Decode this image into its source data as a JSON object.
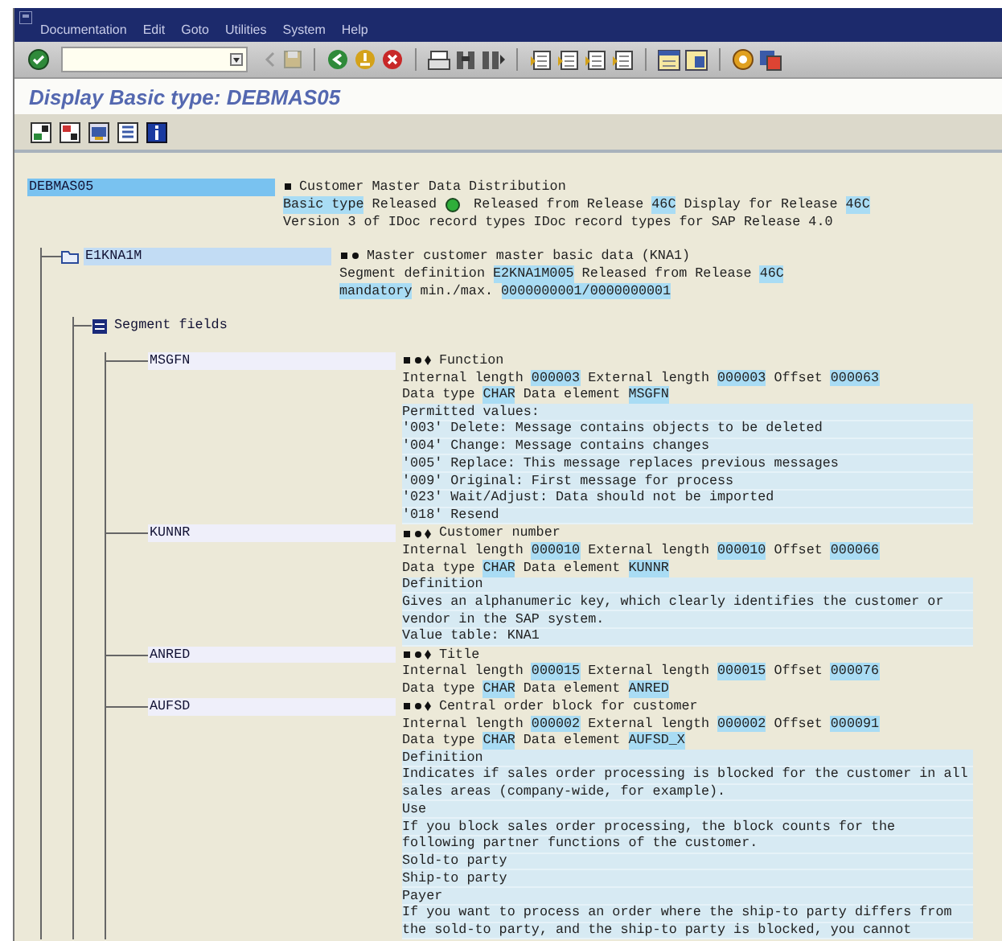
{
  "menu": [
    "Documentation",
    "Edit",
    "Goto",
    "Utilities",
    "System",
    "Help"
  ],
  "title": "Display Basic type: DEBMAS05",
  "tree": {
    "kind": "basic_type",
    "label": "DEBMAS05",
    "selected": true,
    "heading": "Customer Master Data Distribution",
    "lines": [
      {
        "shaded": false,
        "parts": [
          {
            "kind": "text",
            "text": "Basic type",
            "highlight": true
          },
          {
            "kind": "text",
            "text": " Released ",
            "highlight": false
          },
          {
            "kind": "light",
            "on": true
          },
          {
            "kind": "text",
            "text": " Released from Release ",
            "highlight": false
          },
          {
            "kind": "text",
            "text": "46C",
            "highlight": true
          },
          {
            "kind": "text",
            "text": " Display for Release ",
            "highlight": false
          },
          {
            "kind": "text",
            "text": "46C",
            "highlight": true
          }
        ]
      },
      {
        "shaded": false,
        "parts": [
          {
            "kind": "text",
            "text": "Version 3 of IDoc record types IDoc record types for SAP Release 4.0",
            "highlight": false
          }
        ]
      }
    ],
    "children": [
      {
        "kind": "segment",
        "label": "E1KNA1M",
        "selected": false,
        "heading": "Master customer master basic data (KNA1)",
        "lines": [
          {
            "shaded": false,
            "parts": [
              {
                "kind": "text",
                "text": "Segment definition ",
                "highlight": false
              },
              {
                "kind": "text",
                "text": "E2KNA1M005",
                "highlight": true
              },
              {
                "kind": "text",
                "text": " Released from Release ",
                "highlight": false
              },
              {
                "kind": "text",
                "text": "46C",
                "highlight": true
              }
            ]
          },
          {
            "shaded": false,
            "parts": [
              {
                "kind": "text",
                "text": "mandatory",
                "highlight": true
              },
              {
                "kind": "text",
                "text": " min./max. ",
                "highlight": false
              },
              {
                "kind": "text",
                "text": "0000000001/0000000001",
                "highlight": true
              }
            ]
          }
        ],
        "children": [
          {
            "kind": "group",
            "label": "Segment fields",
            "children": [
              {
                "kind": "field",
                "label": "MSGFN",
                "heading": "Function",
                "lines": [
                  {
                    "shaded": false,
                    "parts": [
                      {
                        "kind": "text",
                        "text": "Internal length ",
                        "highlight": false
                      },
                      {
                        "kind": "text",
                        "text": "000003",
                        "highlight": true
                      },
                      {
                        "kind": "text",
                        "text": " External length ",
                        "highlight": false
                      },
                      {
                        "kind": "text",
                        "text": "000003",
                        "highlight": true
                      },
                      {
                        "kind": "text",
                        "text": " Offset ",
                        "highlight": false
                      },
                      {
                        "kind": "text",
                        "text": "000063",
                        "highlight": true
                      }
                    ]
                  },
                  {
                    "shaded": false,
                    "parts": [
                      {
                        "kind": "text",
                        "text": "Data type ",
                        "highlight": false
                      },
                      {
                        "kind": "text",
                        "text": "CHAR",
                        "highlight": true
                      },
                      {
                        "kind": "text",
                        "text": " Data element ",
                        "highlight": false
                      },
                      {
                        "kind": "text",
                        "text": "MSGFN",
                        "highlight": true
                      }
                    ]
                  },
                  {
                    "shaded": true,
                    "parts": [
                      {
                        "kind": "text",
                        "text": "Permitted values:",
                        "highlight": false
                      }
                    ]
                  },
                  {
                    "shaded": true,
                    "parts": [
                      {
                        "kind": "text",
                        "text": "'003' Delete: Message contains objects to be deleted",
                        "highlight": false
                      }
                    ]
                  },
                  {
                    "shaded": true,
                    "parts": [
                      {
                        "kind": "text",
                        "text": "'004' Change: Message contains changes",
                        "highlight": false
                      }
                    ]
                  },
                  {
                    "shaded": true,
                    "parts": [
                      {
                        "kind": "text",
                        "text": "'005' Replace: This message replaces previous messages",
                        "highlight": false
                      }
                    ]
                  },
                  {
                    "shaded": true,
                    "parts": [
                      {
                        "kind": "text",
                        "text": "'009' Original: First message for process",
                        "highlight": false
                      }
                    ]
                  },
                  {
                    "shaded": true,
                    "parts": [
                      {
                        "kind": "text",
                        "text": "'023' Wait/Adjust: Data should not be imported",
                        "highlight": false
                      }
                    ]
                  },
                  {
                    "shaded": true,
                    "parts": [
                      {
                        "kind": "text",
                        "text": "'018' Resend",
                        "highlight": false
                      }
                    ]
                  }
                ]
              },
              {
                "kind": "field",
                "label": "KUNNR",
                "heading": "Customer number",
                "lines": [
                  {
                    "shaded": false,
                    "parts": [
                      {
                        "kind": "text",
                        "text": "Internal length ",
                        "highlight": false
                      },
                      {
                        "kind": "text",
                        "text": "000010",
                        "highlight": true
                      },
                      {
                        "kind": "text",
                        "text": " External length ",
                        "highlight": false
                      },
                      {
                        "kind": "text",
                        "text": "000010",
                        "highlight": true
                      },
                      {
                        "kind": "text",
                        "text": " Offset ",
                        "highlight": false
                      },
                      {
                        "kind": "text",
                        "text": "000066",
                        "highlight": true
                      }
                    ]
                  },
                  {
                    "shaded": false,
                    "parts": [
                      {
                        "kind": "text",
                        "text": "Data type ",
                        "highlight": false
                      },
                      {
                        "kind": "text",
                        "text": "CHAR",
                        "highlight": true
                      },
                      {
                        "kind": "text",
                        "text": " Data element ",
                        "highlight": false
                      },
                      {
                        "kind": "text",
                        "text": "KUNNR",
                        "highlight": true
                      }
                    ]
                  },
                  {
                    "shaded": true,
                    "parts": [
                      {
                        "kind": "text",
                        "text": "Definition",
                        "highlight": false
                      }
                    ]
                  },
                  {
                    "shaded": true,
                    "parts": [
                      {
                        "kind": "text",
                        "text": "Gives an alphanumeric key, which clearly identifies the customer or",
                        "highlight": false
                      }
                    ]
                  },
                  {
                    "shaded": true,
                    "parts": [
                      {
                        "kind": "text",
                        "text": "vendor in the SAP system.",
                        "highlight": false
                      }
                    ]
                  },
                  {
                    "shaded": true,
                    "parts": [
                      {
                        "kind": "text",
                        "text": "Value table: KNA1",
                        "highlight": false
                      }
                    ]
                  }
                ]
              },
              {
                "kind": "field",
                "label": "ANRED",
                "heading": "Title",
                "lines": [
                  {
                    "shaded": false,
                    "parts": [
                      {
                        "kind": "text",
                        "text": "Internal length ",
                        "highlight": false
                      },
                      {
                        "kind": "text",
                        "text": "000015",
                        "highlight": true
                      },
                      {
                        "kind": "text",
                        "text": " External length ",
                        "highlight": false
                      },
                      {
                        "kind": "text",
                        "text": "000015",
                        "highlight": true
                      },
                      {
                        "kind": "text",
                        "text": " Offset ",
                        "highlight": false
                      },
                      {
                        "kind": "text",
                        "text": "000076",
                        "highlight": true
                      }
                    ]
                  },
                  {
                    "shaded": false,
                    "parts": [
                      {
                        "kind": "text",
                        "text": "Data type ",
                        "highlight": false
                      },
                      {
                        "kind": "text",
                        "text": "CHAR",
                        "highlight": true
                      },
                      {
                        "kind": "text",
                        "text": " Data element ",
                        "highlight": false
                      },
                      {
                        "kind": "text",
                        "text": "ANRED",
                        "highlight": true
                      }
                    ]
                  }
                ]
              },
              {
                "kind": "field",
                "label": "AUFSD",
                "heading": "Central order block for customer",
                "lines": [
                  {
                    "shaded": false,
                    "parts": [
                      {
                        "kind": "text",
                        "text": "Internal length ",
                        "highlight": false
                      },
                      {
                        "kind": "text",
                        "text": "000002",
                        "highlight": true
                      },
                      {
                        "kind": "text",
                        "text": " External length ",
                        "highlight": false
                      },
                      {
                        "kind": "text",
                        "text": "000002",
                        "highlight": true
                      },
                      {
                        "kind": "text",
                        "text": " Offset ",
                        "highlight": false
                      },
                      {
                        "kind": "text",
                        "text": "000091",
                        "highlight": true
                      }
                    ]
                  },
                  {
                    "shaded": false,
                    "parts": [
                      {
                        "kind": "text",
                        "text": "Data type ",
                        "highlight": false
                      },
                      {
                        "kind": "text",
                        "text": "CHAR",
                        "highlight": true
                      },
                      {
                        "kind": "text",
                        "text": " Data element ",
                        "highlight": false
                      },
                      {
                        "kind": "text",
                        "text": "AUFSD_X",
                        "highlight": true
                      }
                    ]
                  },
                  {
                    "shaded": true,
                    "parts": [
                      {
                        "kind": "text",
                        "text": "Definition",
                        "highlight": false
                      }
                    ]
                  },
                  {
                    "shaded": true,
                    "parts": [
                      {
                        "kind": "text",
                        "text": "Indicates if sales order processing is blocked for the customer in all",
                        "highlight": false
                      }
                    ]
                  },
                  {
                    "shaded": true,
                    "parts": [
                      {
                        "kind": "text",
                        "text": "sales areas (company-wide, for example).",
                        "highlight": false
                      }
                    ]
                  },
                  {
                    "shaded": true,
                    "parts": [
                      {
                        "kind": "text",
                        "text": "Use",
                        "highlight": false
                      }
                    ]
                  },
                  {
                    "shaded": true,
                    "parts": [
                      {
                        "kind": "text",
                        "text": "If you block sales order processing, the block counts for the",
                        "highlight": false
                      }
                    ]
                  },
                  {
                    "shaded": true,
                    "parts": [
                      {
                        "kind": "text",
                        "text": "following partner functions of the customer.",
                        "highlight": false
                      }
                    ]
                  },
                  {
                    "shaded": true,
                    "parts": [
                      {
                        "kind": "text",
                        "text": "Sold-to party",
                        "highlight": false
                      }
                    ]
                  },
                  {
                    "shaded": true,
                    "parts": [
                      {
                        "kind": "text",
                        "text": "Ship-to party",
                        "highlight": false
                      }
                    ]
                  },
                  {
                    "shaded": true,
                    "parts": [
                      {
                        "kind": "text",
                        "text": "Payer",
                        "highlight": false
                      }
                    ]
                  },
                  {
                    "shaded": true,
                    "parts": [
                      {
                        "kind": "text",
                        "text": "If you want to process an order where the ship-to party differs from",
                        "highlight": false
                      }
                    ]
                  },
                  {
                    "shaded": true,
                    "parts": [
                      {
                        "kind": "text",
                        "text": "the sold-to party, and the ship-to party is blocked, you cannot",
                        "highlight": false
                      }
                    ]
                  }
                ]
              }
            ]
          }
        ]
      }
    ]
  }
}
